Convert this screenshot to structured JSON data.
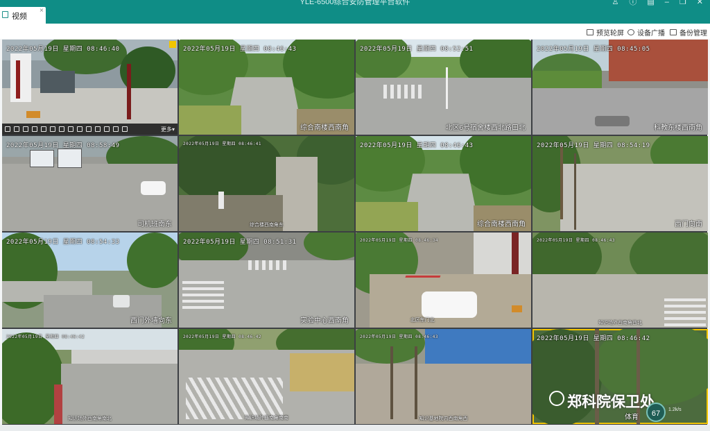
{
  "app": {
    "title": "YLE-6500综合安防管理平台软件"
  },
  "tab": {
    "label": "视频",
    "close": "×"
  },
  "window_controls": [
    "user-icon",
    "info-icon",
    "menu-icon",
    "minimize-icon",
    "maximize-icon",
    "close-icon"
  ],
  "window_glyphs": [
    "♙",
    "ⓘ",
    "▤",
    "–",
    "❐",
    "✕"
  ],
  "toolbar": {
    "preview_polling": "预览轮屏",
    "broadcast": "设备广播",
    "backup": "备份管理"
  },
  "ptz_more": "更多▾",
  "cameras": [
    {
      "ts": "2022年05月19日 星期四 08:46:40",
      "label": ""
    },
    {
      "ts": "2022年05月19日 星期四 08:46:43",
      "label": "综合南楼西南角"
    },
    {
      "ts": "2022年05月19日 星期四 08:52:51",
      "label": "北区6号宿舍楼西北路口北"
    },
    {
      "ts": "2022年05月19日 星期四 08:45:05",
      "label": "科教东楼西南角"
    },
    {
      "ts": "2022年05月19日 星期四 08:58:49",
      "label": "司机班南东"
    },
    {
      "ts": "2022年05月19日 星期四 08:46:41",
      "label": "综合楼西南角东"
    },
    {
      "ts": "2022年05月19日 星期四 08:46:43",
      "label": "综合南楼西南角"
    },
    {
      "ts": "2022年05月19日 星期四 08:54:19",
      "label": "西门向南"
    },
    {
      "ts": "2022年05月19日 星期四 08:54:33",
      "label": "西门外墙向东"
    },
    {
      "ts": "2022年05月19日 星期四 08:51:31",
      "label": "实验中心西南角"
    },
    {
      "ts": "2022年05月19日 星期四 08:46:34",
      "label": "北区东门北"
    },
    {
      "ts": "2022年05月19日 星期四 08:46:43",
      "label": "知识场外西南角西北"
    },
    {
      "ts": "2022年05月19日 星期四 08:46:42",
      "label": "知识场外西南角南北"
    },
    {
      "ts": "2022年05月19日 星期四 08:46:42",
      "label": "知识场外西南角南南"
    },
    {
      "ts": "2022年05月19日 星期四 08:46:43",
      "label": "知识基地院内西南角西"
    },
    {
      "ts": "2022年05月19日 星期四 08:46:42",
      "label": "体育"
    }
  ],
  "watermark": "郑科院保卫处",
  "speed": {
    "value": "67",
    "unit": "%",
    "info": "1.2k/s"
  }
}
